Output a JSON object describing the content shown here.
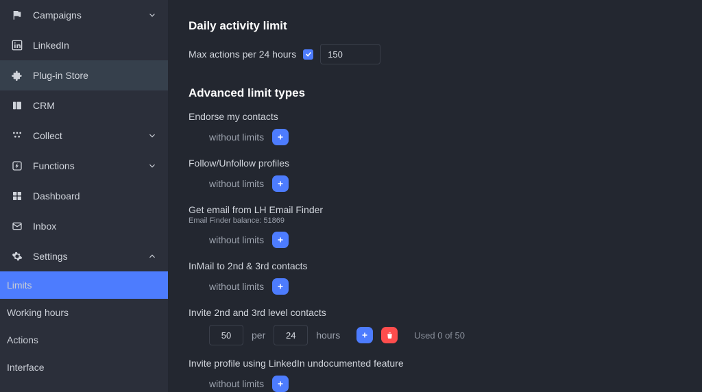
{
  "sidebar": {
    "items": [
      {
        "label": "Campaigns"
      },
      {
        "label": "LinkedIn"
      },
      {
        "label": "Plug-in Store"
      },
      {
        "label": "CRM"
      },
      {
        "label": "Collect"
      },
      {
        "label": "Functions"
      },
      {
        "label": "Dashboard"
      },
      {
        "label": "Inbox"
      },
      {
        "label": "Settings"
      }
    ],
    "sub": {
      "limits": "Limits",
      "working_hours": "Working hours",
      "actions": "Actions",
      "interface": "Interface"
    }
  },
  "main": {
    "daily_title": "Daily activity limit",
    "daily_label": "Max actions per 24 hours",
    "daily_value": "150",
    "advanced_title": "Advanced limit types",
    "without_limits": "without limits",
    "per": "per",
    "hours": "hours",
    "limits": [
      {
        "title": "Endorse my contacts"
      },
      {
        "title": "Follow/Unfollow profiles"
      },
      {
        "title": "Get email from LH Email Finder",
        "subtitle": "Email Finder balance: 51869"
      },
      {
        "title": "InMail to 2nd & 3rd contacts"
      },
      {
        "title": "Invite 2nd and 3rd level contacts",
        "qty": "50",
        "interval": "24",
        "used": "Used 0 of 50"
      },
      {
        "title": "Invite profile using LinkedIn undocumented feature"
      }
    ]
  }
}
